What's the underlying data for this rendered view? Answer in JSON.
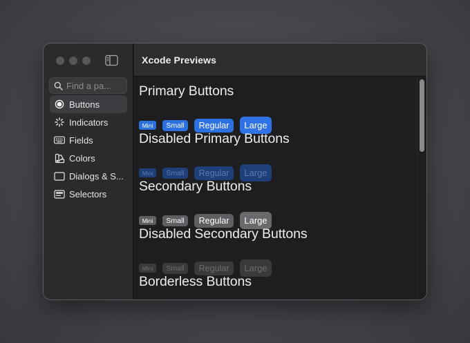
{
  "window": {
    "title": "Xcode Previews"
  },
  "sidebar": {
    "search_placeholder": "Find a pa...",
    "items": [
      {
        "label": "Buttons",
        "icon": "radio-button-icon",
        "selected": true
      },
      {
        "label": "Indicators",
        "icon": "spinner-icon",
        "selected": false
      },
      {
        "label": "Fields",
        "icon": "keyboard-icon",
        "selected": false
      },
      {
        "label": "Colors",
        "icon": "swatch-icon",
        "selected": false
      },
      {
        "label": "Dialogs & S...",
        "icon": "dialog-icon",
        "selected": false
      },
      {
        "label": "Selectors",
        "icon": "selector-icon",
        "selected": false
      }
    ]
  },
  "sections": [
    {
      "title": "Primary Buttons",
      "style": "primary",
      "buttons": [
        "Mini",
        "Small",
        "Regular",
        "Large"
      ]
    },
    {
      "title": "Disabled Primary Buttons",
      "style": "primary-disabled",
      "buttons": [
        "Mini",
        "Small",
        "Regular",
        "Large"
      ]
    },
    {
      "title": "Secondary Buttons",
      "style": "secondary",
      "buttons": [
        "Mini",
        "Small",
        "Regular",
        "Large"
      ]
    },
    {
      "title": "Disabled Secondary Buttons",
      "style": "secondary-disabled",
      "buttons": [
        "Mini",
        "Small",
        "Regular",
        "Large"
      ]
    },
    {
      "title": "Borderless Buttons",
      "style": "borderless",
      "buttons": []
    }
  ],
  "colors": {
    "accent": "#2d70e0",
    "accent_disabled": "#1f3f78",
    "secondary": "#5f5f63",
    "secondary_disabled": "#3a3a3d"
  }
}
